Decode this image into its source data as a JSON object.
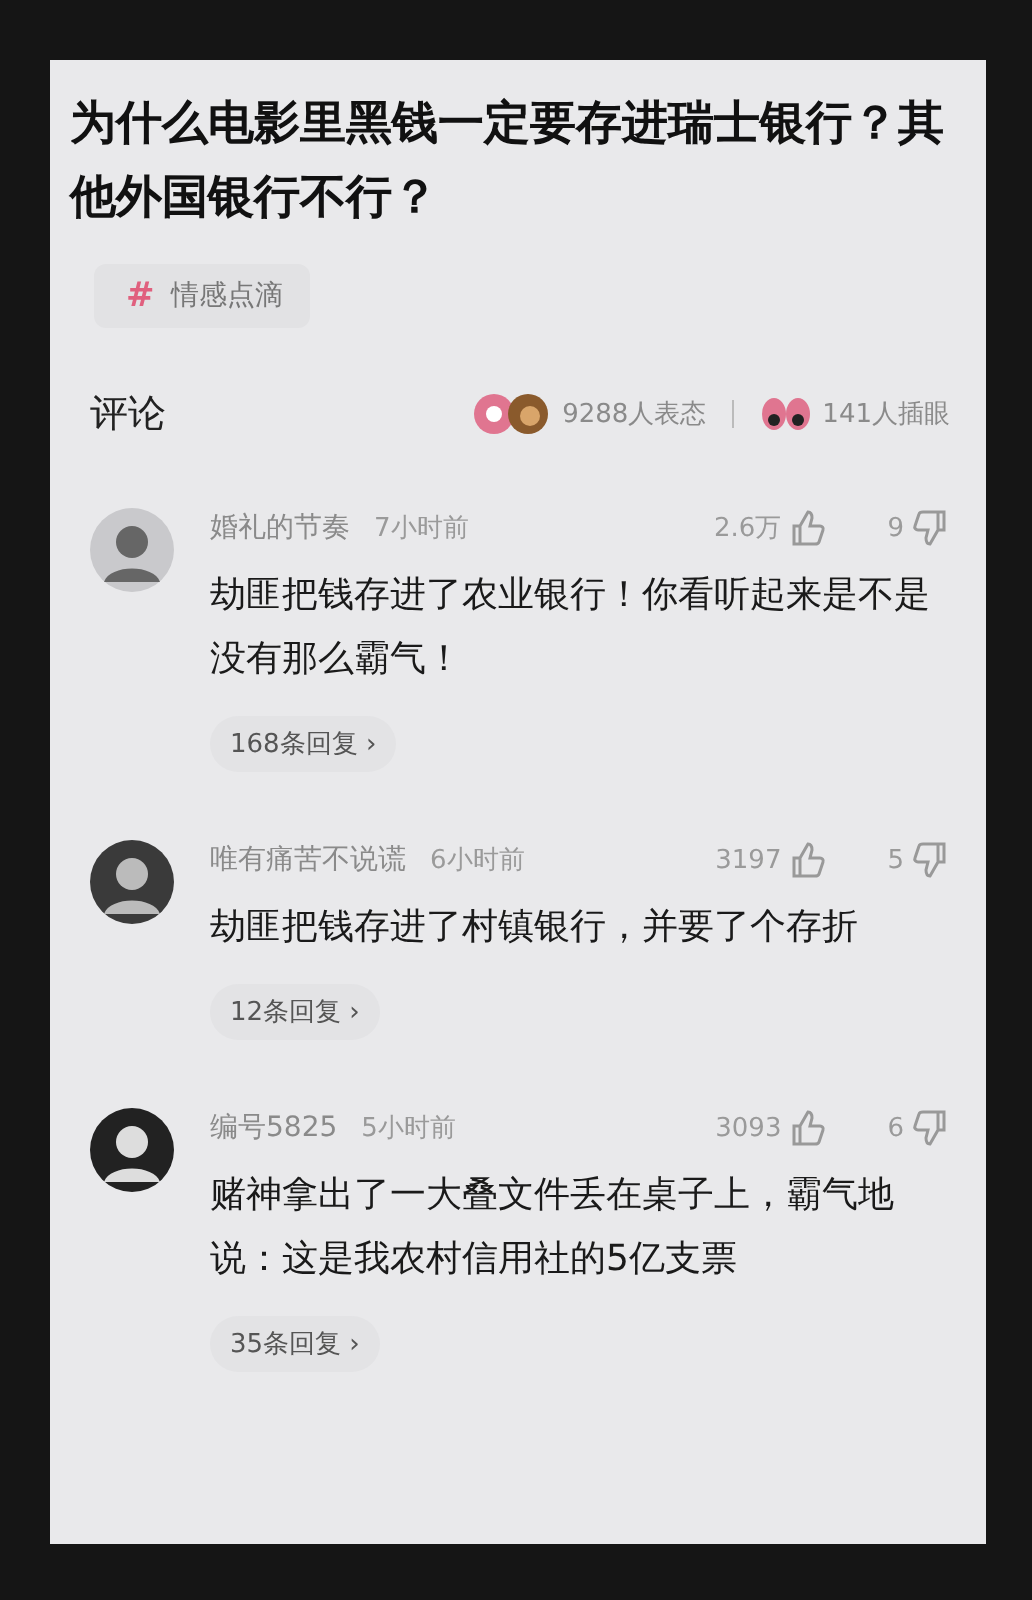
{
  "title": "为什么电影里黑钱一定要存进瑞士银行？其他外国银行不行？",
  "topic": {
    "symbol": "#",
    "label": "情感点滴"
  },
  "comments_header": {
    "label": "评论",
    "reactions": "9288人表态",
    "eye_reactions": "141人插眼"
  },
  "comments": [
    {
      "user": "婚礼的节奏",
      "time": "7小时前",
      "likes": "2.6万",
      "dislikes": "9",
      "text": "劫匪把钱存进了农业银行！你看听起来是不是没有那么霸气！",
      "replies": "168条回复 ›"
    },
    {
      "user": "唯有痛苦不说谎",
      "time": "6小时前",
      "likes": "3197",
      "dislikes": "5",
      "text": "劫匪把钱存进了村镇银行，并要了个存折",
      "replies": "12条回复 ›"
    },
    {
      "user": "编号5825",
      "time": "5小时前",
      "likes": "3093",
      "dislikes": "6",
      "text": "赌神拿出了一大叠文件丢在桌子上，霸气地说：这是我农村信用社的5亿支票",
      "replies": "35条回复 ›"
    }
  ]
}
